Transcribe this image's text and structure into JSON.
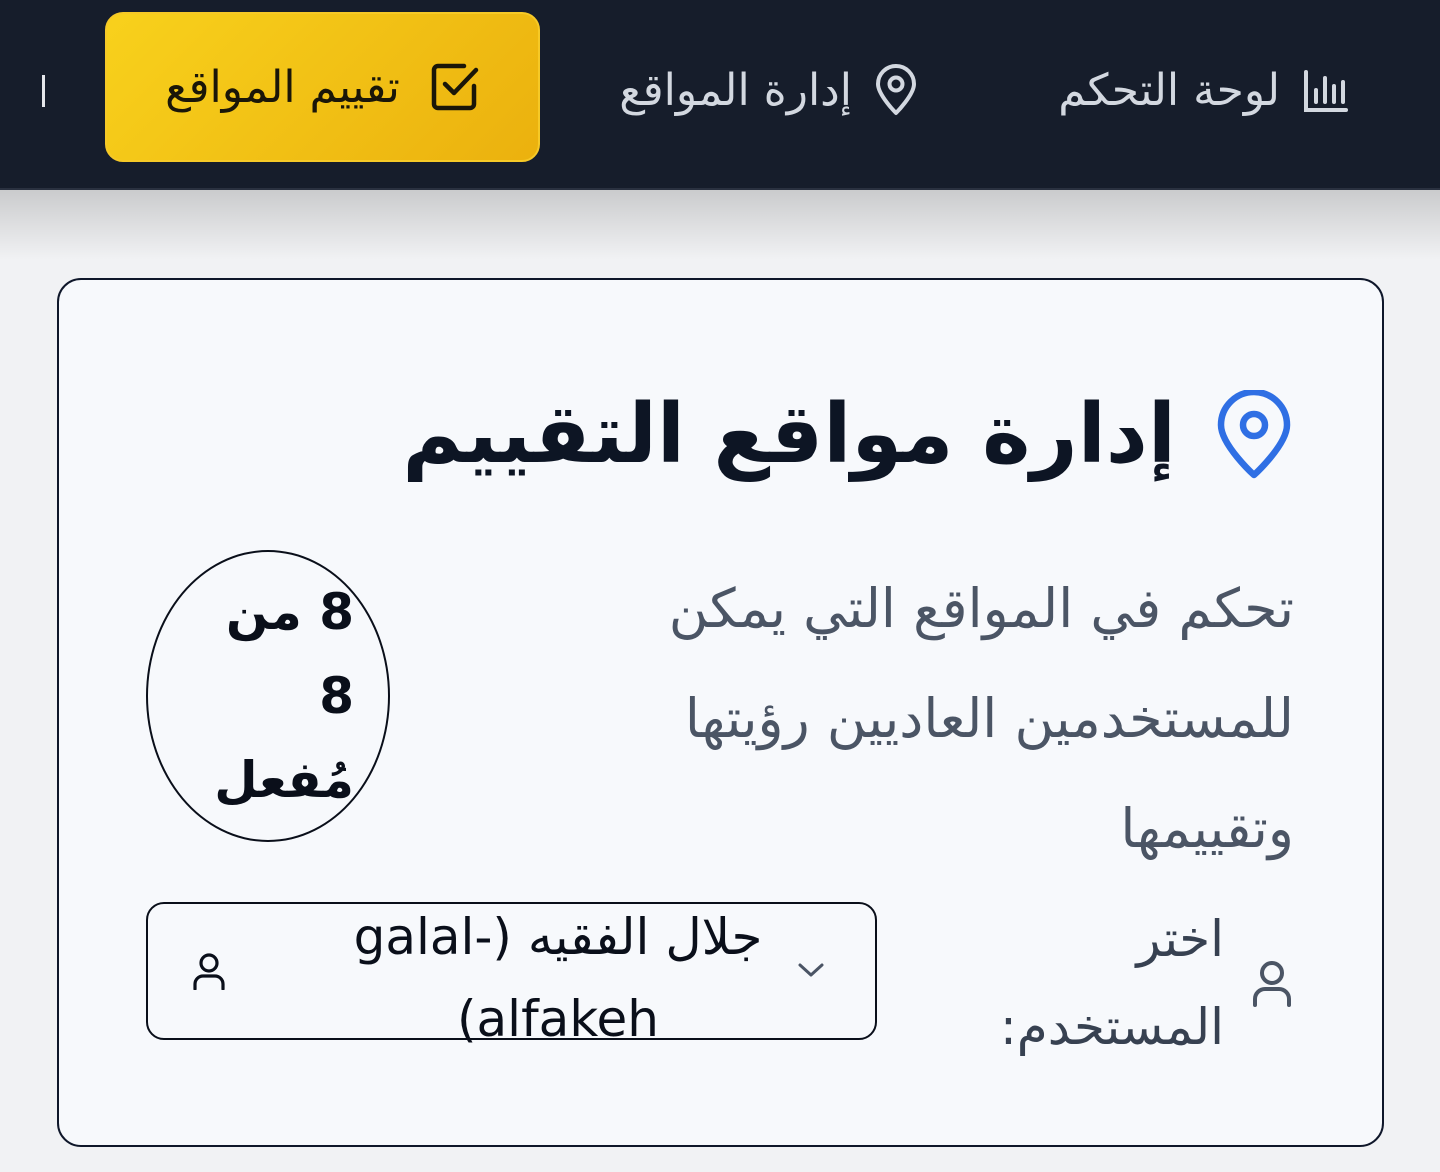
{
  "nav": {
    "dashboard_label": "لوحة التحكم",
    "manage_label": "إدارة المواقع",
    "rate_label": "تقييم المواقع",
    "icons": {
      "dashboard": "bar-chart-icon",
      "manage": "map-pin-icon",
      "rate": "checkbox-icon"
    },
    "active_color": "#f5c518"
  },
  "card": {
    "title": "إدارة مواقع التقييم",
    "title_icon": "map-pin-icon",
    "title_icon_color": "#2f6fe4",
    "description": "تحكم في المواقع التي يمكن للمستخدمين العاديين رؤيتها وتقييمها",
    "count": {
      "line1": "8 من",
      "line2": "8",
      "line3": "مُفعل"
    },
    "user_select": {
      "label": "اختر المستخدم:",
      "label_icon": "user-icon",
      "value": "جلال الفقيه (galal-alfakeh)",
      "icon": "user-icon",
      "chevron": "chevron-down-icon"
    }
  }
}
